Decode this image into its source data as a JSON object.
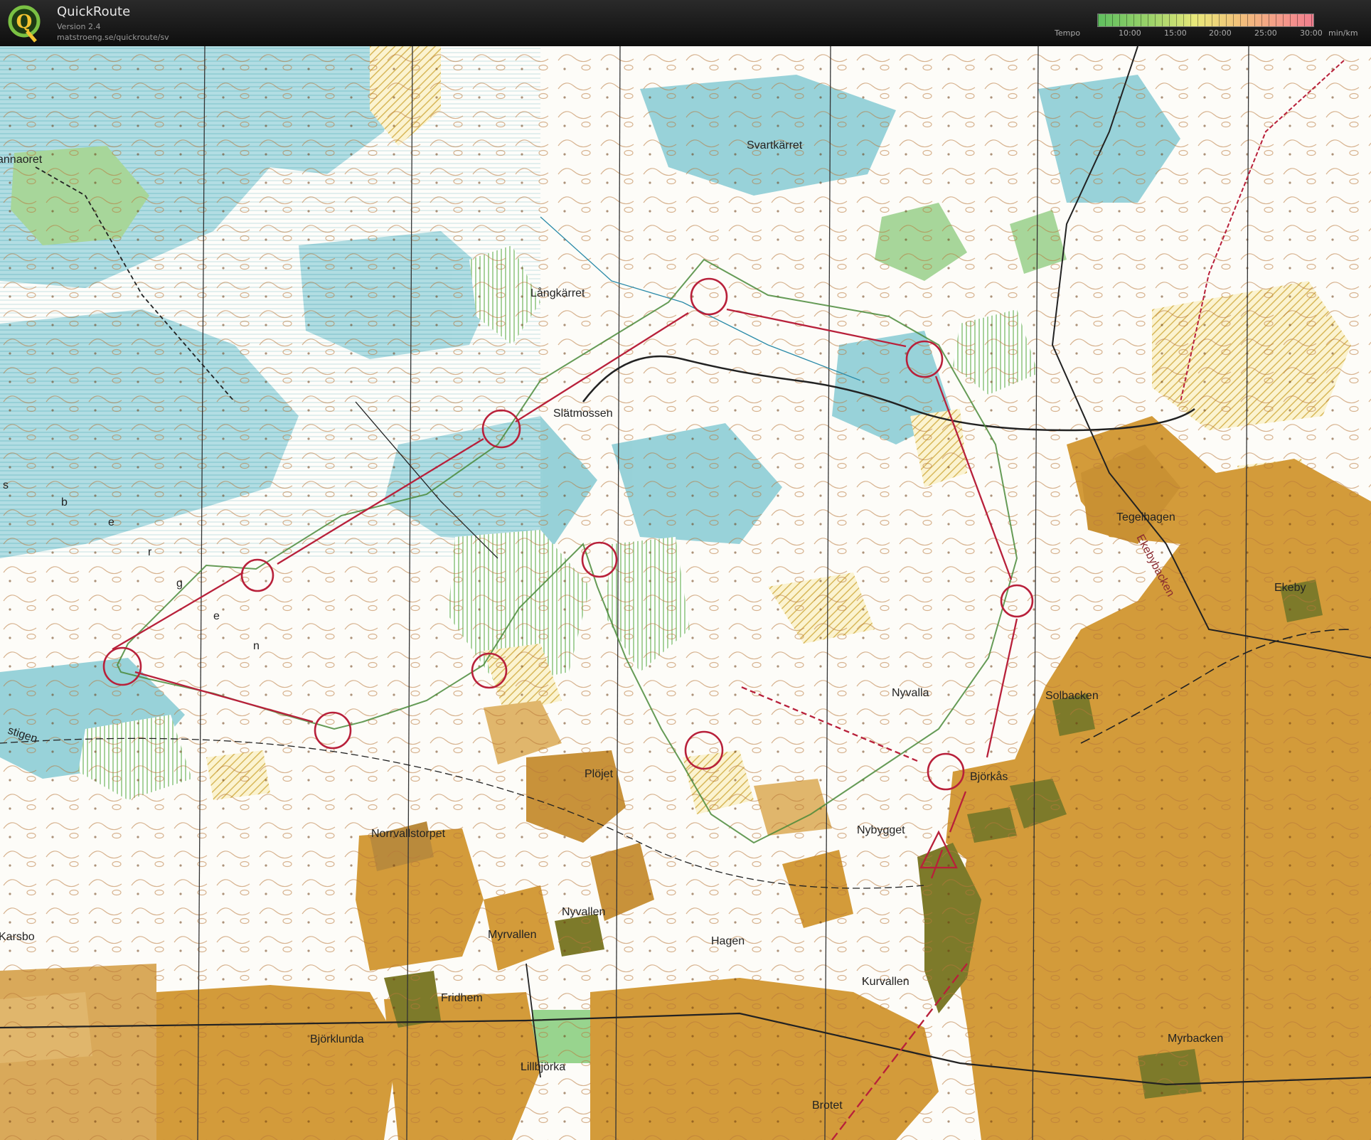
{
  "app": {
    "title": "QuickRoute",
    "version": "Version 2.4",
    "url": "matstroeng.se/quickroute/sv"
  },
  "tempo": {
    "label": "Tempo",
    "ticks": [
      "10:00",
      "15:00",
      "20:00",
      "25:00",
      "30:00"
    ],
    "unit": "min/km"
  },
  "map": {
    "place_names": [
      "annaoret",
      "Svartkärret",
      "Långkärret",
      "Slätmossen",
      "Tegelhagen",
      "Ekebybacken",
      "Ekeby",
      "Nyvalla",
      "Solbacken",
      "Björkås",
      "Plöjet",
      "Norrvallstorpet",
      "Nybygget",
      "Nyvallen",
      "Myrvallen",
      "Hagen",
      "Kurvallen",
      "Fridhem",
      "Björklunda",
      "Lillbjörka",
      "Myrbacken",
      "Brotet",
      "Karsbo",
      "stigen",
      "s",
      "b",
      "e",
      "r",
      "g",
      "e",
      "n"
    ],
    "colors": {
      "field": "#d39b3a",
      "rough_open": "#f0d77a",
      "marsh_blue": "#7ec8cf",
      "forest_green": "#9fd190",
      "contour": "#a8692f",
      "course": "#b8203a",
      "route": "#4a8a3a"
    }
  }
}
